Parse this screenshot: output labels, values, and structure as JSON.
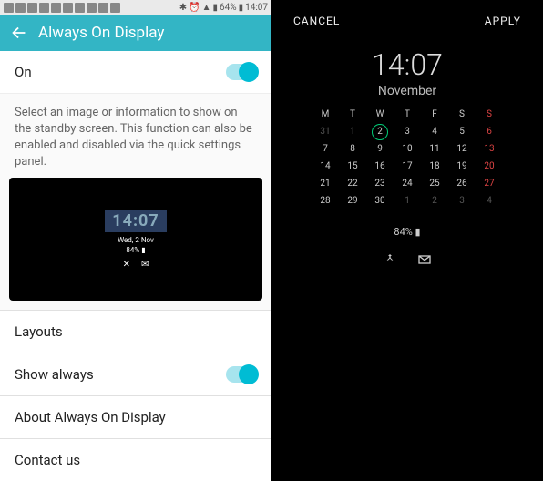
{
  "status": {
    "battery": "64%",
    "time": "14:07"
  },
  "header": {
    "title": "Always On Display"
  },
  "on_row": {
    "label": "On"
  },
  "description": "Select an image or information to show on the standby screen. This function can also be enabled and disabled via the quick settings panel.",
  "preview": {
    "time": "14:07",
    "date": "Wed, 2 Nov",
    "battery": "84%"
  },
  "menu": {
    "layouts": "Layouts",
    "show_always": "Show always",
    "about": "About Always On Display",
    "contact": "Contact us"
  },
  "right": {
    "cancel": "CANCEL",
    "apply": "APPLY",
    "time": "14:07",
    "month": "November",
    "battery": "84%",
    "days": [
      "M",
      "T",
      "W",
      "T",
      "F",
      "S",
      "S"
    ],
    "weeks": [
      [
        {
          "d": "31",
          "dim": true
        },
        {
          "d": "1"
        },
        {
          "d": "2",
          "sel": true
        },
        {
          "d": "3"
        },
        {
          "d": "4"
        },
        {
          "d": "5"
        },
        {
          "d": "6",
          "red": true
        }
      ],
      [
        {
          "d": "7"
        },
        {
          "d": "8"
        },
        {
          "d": "9"
        },
        {
          "d": "10"
        },
        {
          "d": "11"
        },
        {
          "d": "12"
        },
        {
          "d": "13",
          "red": true
        }
      ],
      [
        {
          "d": "14"
        },
        {
          "d": "15"
        },
        {
          "d": "16"
        },
        {
          "d": "17"
        },
        {
          "d": "18"
        },
        {
          "d": "19"
        },
        {
          "d": "20",
          "red": true
        }
      ],
      [
        {
          "d": "21"
        },
        {
          "d": "22"
        },
        {
          "d": "23"
        },
        {
          "d": "24"
        },
        {
          "d": "25"
        },
        {
          "d": "26"
        },
        {
          "d": "27",
          "red": true
        }
      ],
      [
        {
          "d": "28"
        },
        {
          "d": "29"
        },
        {
          "d": "30"
        },
        {
          "d": "1",
          "dim": true
        },
        {
          "d": "2",
          "dim": true
        },
        {
          "d": "3",
          "dim": true
        },
        {
          "d": "4",
          "dim": true
        }
      ]
    ]
  }
}
